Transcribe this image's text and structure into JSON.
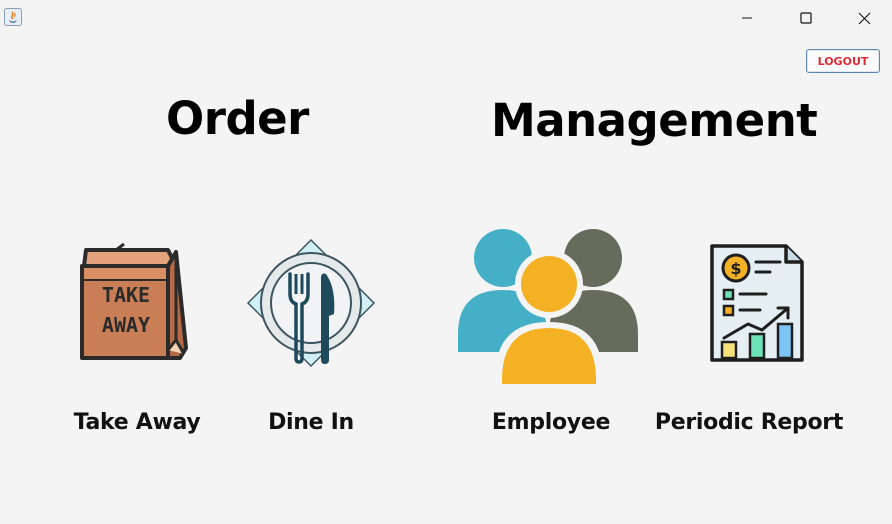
{
  "window": {
    "controls": {
      "minimize_icon": "minimize-icon",
      "maximize_icon": "maximize-icon",
      "close_icon": "close-icon"
    }
  },
  "header": {
    "logout_label": "LOGOUT"
  },
  "sections": {
    "order_title": "Order",
    "management_title": "Management"
  },
  "tiles": [
    {
      "label": "Take Away",
      "icon": "take-away-bag-icon",
      "icon_text_line1": "TAKE",
      "icon_text_line2": "AWAY"
    },
    {
      "label": "Dine In",
      "icon": "dine-in-plate-icon"
    },
    {
      "label": "Employee",
      "icon": "employee-group-icon"
    },
    {
      "label": "Periodic Report",
      "icon": "periodic-report-icon"
    }
  ],
  "colors": {
    "logout_text": "#dc2b32",
    "logout_border": "#5f86b0",
    "employee_blue": "#45afc7",
    "employee_gray": "#676b5b",
    "employee_yellow": "#f5b124",
    "bag_brown": "#c97e56"
  }
}
